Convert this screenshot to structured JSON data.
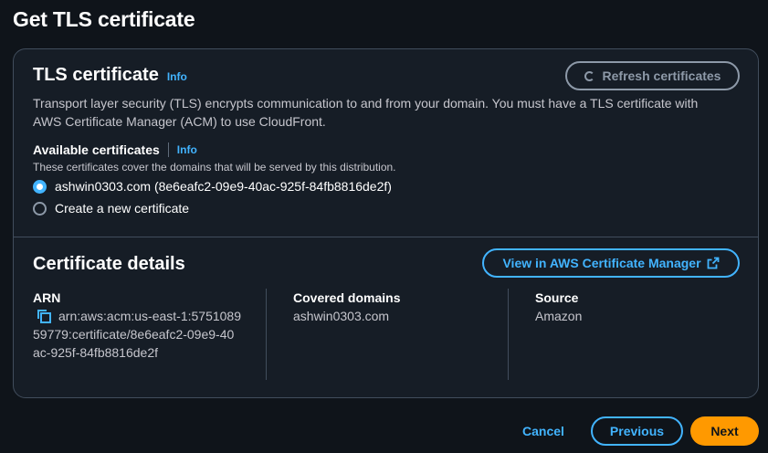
{
  "page": {
    "title": "Get TLS certificate"
  },
  "tls": {
    "heading": "TLS certificate",
    "info": "Info",
    "refresh_label": "Refresh certificates",
    "description": "Transport layer security (TLS) encrypts communication to and from your domain. You must have a TLS certificate with AWS Certificate Manager (ACM) to use CloudFront.",
    "field_label": "Available certificates",
    "field_info": "Info",
    "field_description": "These certificates cover the domains that will be served by this distribution.",
    "options": [
      {
        "label": "ashwin0303.com (8e6eafc2-09e9-40ac-925f-84fb8816de2f)",
        "selected": true
      },
      {
        "label": "Create a new certificate",
        "selected": false
      }
    ]
  },
  "details": {
    "heading": "Certificate details",
    "view_label": "View in AWS Certificate Manager",
    "arn_label": "ARN",
    "arn_value": "arn:aws:acm:us-east-1:575108959779:certificate/8e6eafc2-09e9-40ac-925f-84fb8816de2f",
    "domains_label": "Covered domains",
    "domains_value": "ashwin0303.com",
    "source_label": "Source",
    "source_value": "Amazon"
  },
  "footer": {
    "cancel_label": "Cancel",
    "previous_label": "Previous",
    "next_label": "Next"
  },
  "colors": {
    "background": "#0f141a",
    "panel": "#161d26",
    "accent": "#42b4ff",
    "primary_button": "#ff9900"
  }
}
